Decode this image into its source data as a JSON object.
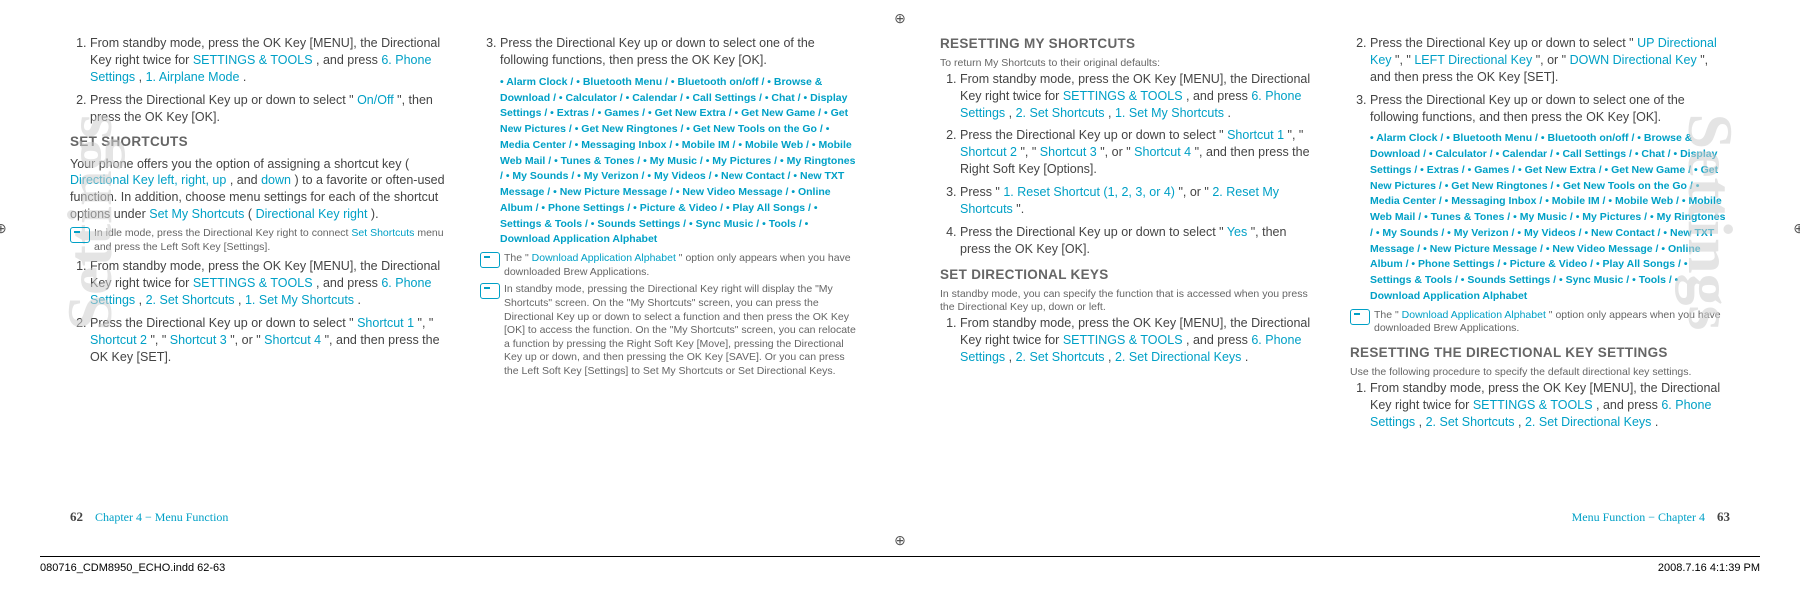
{
  "sidetitle": "Settings",
  "page_left": {
    "num": "62",
    "chapter": "Chapter 4 − Menu Function",
    "col1": {
      "step1": "From standby mode, press the OK Key      [MENU], the Directional Key      right twice for ",
      "step1b": "SETTINGS & TOOLS",
      "step1c": ", and press ",
      "step1d": "6. Phone Settings",
      "step1e": ", ",
      "step1f": "1. Airplane Mode",
      "step1g": ".",
      "step2": "Press the Directional Key      up or down to select \"",
      "step2b": "On/Off",
      "step2c": "\", then press the OK Key      [OK].",
      "h_set": "SET SHORTCUTS",
      "para1a": "Your phone offers you the option of assigning a shortcut key (",
      "para1b": "Directional Key left, right, up",
      "para1c": ", and ",
      "para1d": "down",
      "para1e": ") to a favorite or often-used function. In addition, choose menu settings for each of the shortcut options under ",
      "para1f": "Set My Shortcuts",
      "para1g": " (",
      "para1h": "Directional Key right",
      "para1i": ").",
      "tip1a": "In idle mode, press the Directional Key      right to connect ",
      "tip1b": "Set Shortcuts",
      "tip1c": " menu and press the Left Soft Key      [Settings].",
      "step3": "From standby mode, press the OK Key      [MENU], the Directional Key      right twice for ",
      "step3b": "SETTINGS & TOOLS",
      "step3c": ", and press ",
      "step3d": "6. Phone Settings",
      "step3e": ", ",
      "step3f": "2. Set Shortcuts",
      "step3g": ", ",
      "step3h": "1. Set My Shortcuts",
      "step3i": ".",
      "step4": "Press the Directional Key      up or down to select \"",
      "sc1": "Shortcut 1",
      "sc2": "Shortcut 2",
      "sc3": "Shortcut 3",
      "sc4": "Shortcut 4",
      "step4b": "\", \"",
      "step4c": "\", \"",
      "step4d": "\", or \"",
      "step4e": "\", and then press the OK Key      [SET]."
    },
    "col2": {
      "step1": "Press the Directional Key      up or down to select one of the following functions, then press the OK Key      [OK].",
      "list": "•  Alarm Clock /  •  Bluetooth Menu /  •  Bluetooth on/off /  •  Browse & Download / •  Calculator /  •  Calendar /  •  Call Settings /  •  Chat /  •  Display Settings /  •  Extras / •  Games /  •  Get New Extra /  •  Get New Game /  •  Get New Pictures / •  Get New Ringtones /  •  Get New Tools on the Go /  •  Media Center / •  Messaging Inbox /  •  Mobile IM /  •  Mobile Web /  •  Mobile Web Mail / •  Tunes & Tones /  •  My Music /  •  My Pictures /  •  My Ringtones /  •  My Sounds / •  My Verizon /  •  My Videos /  •  New Contact /  •  New TXT Message / •  New Picture Message /  •  New Video Message /  •  Online Album / •  Phone Settings /  •  Picture & Video /   •  Play All Songs /  •  Settings & Tools / •  Sounds Settings /  •  Sync Music /  •  Tools /  •  Download Application Alphabet",
      "tip1a": "The \"",
      "tip1b": "Download Application Alphabet",
      "tip1c": "\" option only appears when you have downloaded Brew Applications.",
      "tip2": "In standby mode, pressing the Directional Key      right will display the \"My Shortcuts\" screen. On the \"My Shortcuts\" screen, you can press the Directional Key      up or down to select a function and then press the OK Key      [OK] to access the function. On the \"My Shortcuts\" screen, you can relocate a function by pressing the Right Soft Key      [Move], pressing the Directional Key      up or down, and then pressing the OK Key      [SAVE]. Or you can press the Left Soft Key      [Settings] to Set My Shortcuts or Set Directional Keys."
    }
  },
  "page_right": {
    "num": "63",
    "chapter": "Menu Function − Chapter 4",
    "col1": {
      "h1": "RESETTING MY SHORTCUTS",
      "p1": "To return My Shortcuts to their original defaults:",
      "s1": "From standby mode, press the OK Key      [MENU], the Directional Key      right twice for ",
      "s1b": "SETTINGS & TOOLS",
      "s1c": ", and press ",
      "s1d": "6. Phone Settings",
      "s1e": ", ",
      "s1f": "2. Set Shortcuts",
      "s1g": ", ",
      "s1h": "1. Set My Shortcuts",
      "s1i": ".",
      "s2": "Press the Directional Key      up or down to select \"",
      "sc1": "Shortcut 1",
      "sc2": "Shortcut 2",
      "sc3": "Shortcut 3",
      "sc4": "Shortcut 4",
      "s2b": "\", \"",
      "s2c": "\", \"",
      "s2d": "\", or \"",
      "s2e": "\", and then press the Right Soft Key      [Options].",
      "s3a": "Press \"",
      "s3b": "1. Reset Shortcut (1, 2, 3, or 4)",
      "s3c": "\", or \"",
      "s3d": "2. Reset My Shortcuts",
      "s3e": "\".",
      "s4a": "Press the Directional Key      up or down to select \"",
      "s4b": "Yes",
      "s4c": "\", then press the OK Key      [OK].",
      "h2": "SET DIRECTIONAL KEYS",
      "p2": "In standby mode, you can specify the function that is accessed when you press the Directional Key      up, down or left.",
      "s5": "From standby mode, press the OK Key      [MENU], the Directional Key      right twice for ",
      "s5b": "SETTINGS & TOOLS",
      "s5c": ", and press ",
      "s5d": "6. Phone Settings",
      "s5e": ", ",
      "s5f": "2. Set Shortcuts",
      "s5g": ", ",
      "s5h": "2. Set Directional Keys",
      "s5i": "."
    },
    "col2": {
      "s1": "Press the Directional Key      up or down to select \"",
      "s1b": "UP Directional Key",
      "s1c": "\", \"",
      "s1d": "LEFT Directional Key",
      "s1e": "\", or \"",
      "s1f": "DOWN Directional Key",
      "s1g": "\", and then press the OK Key      [SET].",
      "s2": "Press the Directional Key      up or down to select one of the following functions, and then press the OK Key      [OK].",
      "list": "•  Alarm Clock /  •  Bluetooth Menu /  •  Bluetooth on/off /  •  Browse & Download / •  Calculator /  •  Calendar /  •  Call Settings /  •  Chat /  •  Display Settings / •  Extras /  •  Games /  •  Get New Extra /  •  Get New Game /  •  Get New Pictures / •  Get New Ringtones /  •  Get New Tools on the Go /  •  Media Center / •  Messaging Inbox /  •  Mobile IM /  •  Mobile Web /  •  Mobile Web Mail / •  Tunes & Tones /  •  My Music /  •  My Pictures /  •  My Ringtones /  •  My Sounds / •  My Verizon /  •  My Videos /  •  New Contact /  •  New TXT Message / •  New Picture Message /  •  New Video Message /  •  Online Album / •  Phone Settings /  •  Picture & Video /   •  Play All Songs /  •  Settings & Tools / •  Sounds Settings /  •  Sync Music /  •  Tools /  •  Download Application Alphabet",
      "tipa": "The \"",
      "tipb": "Download Application Alphabet",
      "tipc": "\" option only appears when you have downloaded Brew Applications.",
      "h1": "RESETTING THE DIRECTIONAL KEY SETTINGS",
      "p1": "Use the following procedure to specify the default directional key settings.",
      "s3": "From standby mode, press the OK Key      [MENU], the Directional Key      right twice for ",
      "s3b": "SETTINGS & TOOLS",
      "s3c": ", and press ",
      "s3d": "6. Phone Settings",
      "s3e": ", ",
      "s3f": "2. Set Shortcuts",
      "s3g": ", ",
      "s3h": "2. Set Directional Keys",
      "s3i": "."
    }
  },
  "printline": {
    "left": "080716_CDM8950_ECHO.indd   62-63",
    "right": "2008.7.16   4:1:39 PM"
  },
  "cropmark": "⊕"
}
